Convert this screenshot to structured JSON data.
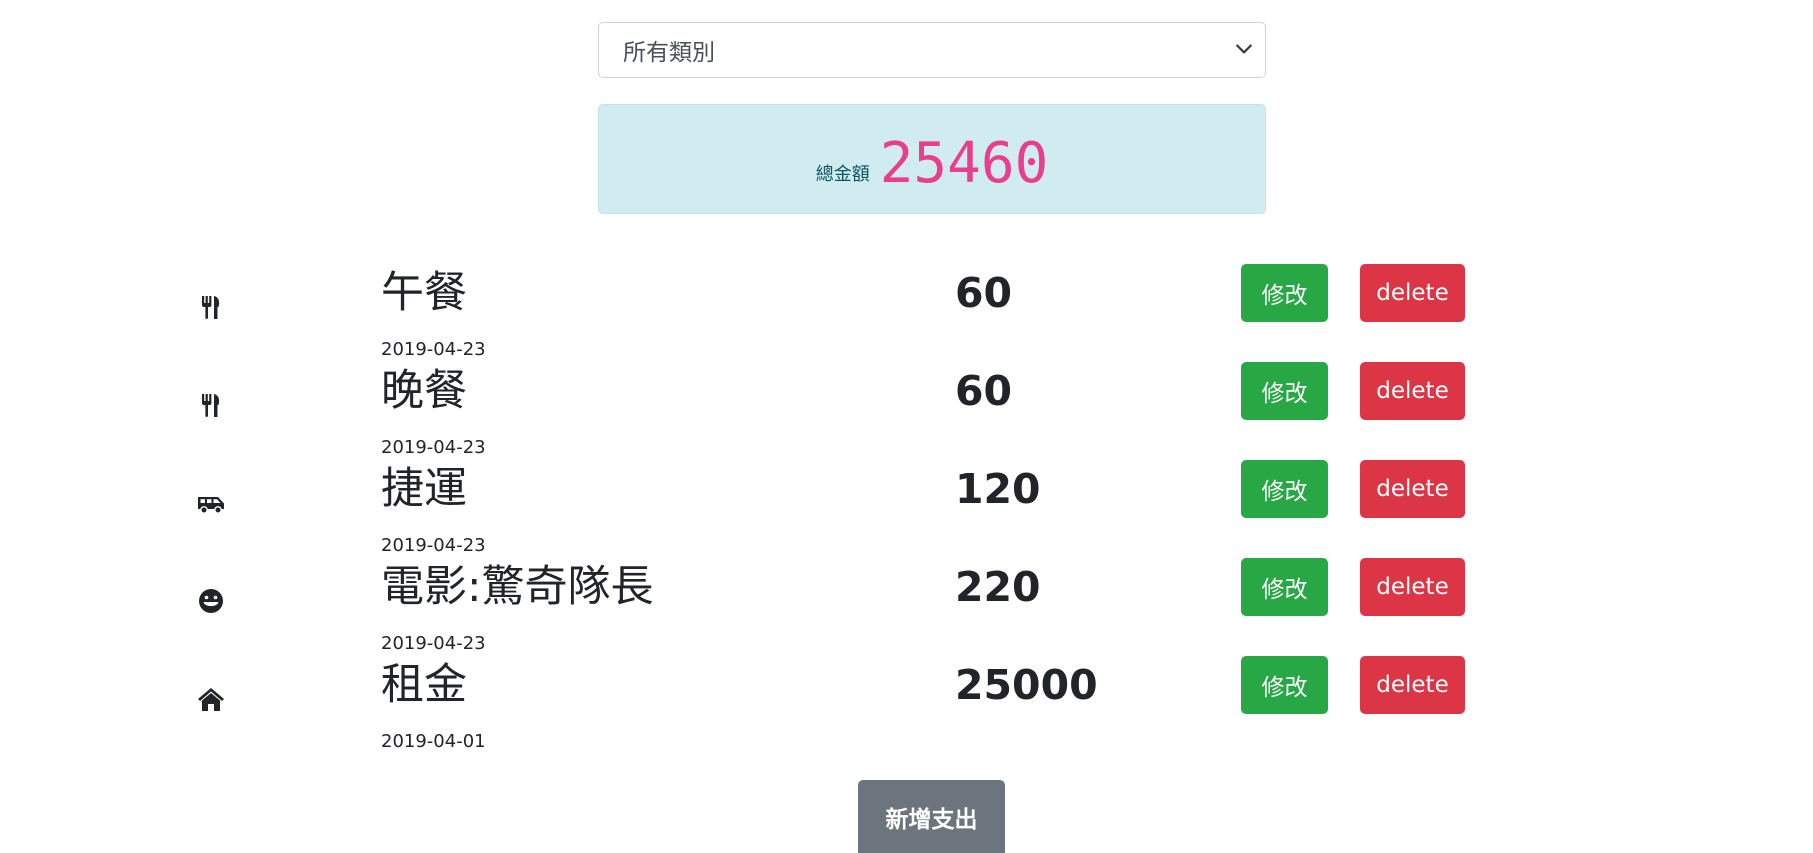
{
  "filter": {
    "selected": "所有類別"
  },
  "summary": {
    "label": "總金額",
    "total": "25460"
  },
  "expenses": [
    {
      "icon": "utensils-icon",
      "name": "午餐",
      "amount": "60",
      "date": "2019-04-23",
      "edit_label": "修改",
      "delete_label": "delete"
    },
    {
      "icon": "utensils-icon",
      "name": "晚餐",
      "amount": "60",
      "date": "2019-04-23",
      "edit_label": "修改",
      "delete_label": "delete"
    },
    {
      "icon": "shuttle-van-icon",
      "name": "捷運",
      "amount": "120",
      "date": "2019-04-23",
      "edit_label": "修改",
      "delete_label": "delete"
    },
    {
      "icon": "grin-icon",
      "name": "電影:驚奇隊長",
      "amount": "220",
      "date": "2019-04-23",
      "edit_label": "修改",
      "delete_label": "delete"
    },
    {
      "icon": "home-icon",
      "name": "租金",
      "amount": "25000",
      "date": "2019-04-01",
      "edit_label": "修改",
      "delete_label": "delete"
    }
  ],
  "actions": {
    "add_label": "新增支出"
  },
  "colors": {
    "edit": "#28a745",
    "delete": "#dc3545",
    "add": "#6c757d",
    "total_bg": "#d1ecf1",
    "total_amount": "#e83e8c",
    "total_label": "#0c5460"
  }
}
